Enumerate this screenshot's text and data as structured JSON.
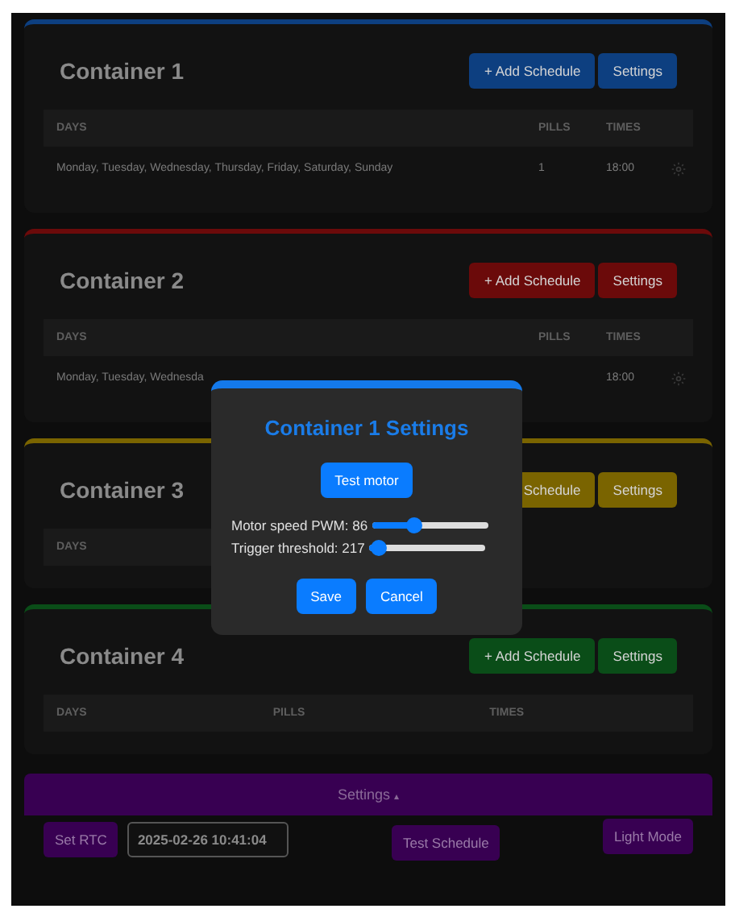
{
  "containers": [
    {
      "title": "Container 1",
      "color": "#0d3f80",
      "buttons": [
        "+ Add Schedule",
        "Settings"
      ],
      "columns": [
        "DAYS",
        "PILLS",
        "TIMES"
      ],
      "rows": [
        {
          "days": "Monday, Tuesday, Wednesday, Thursday, Friday, Saturday, Sunday",
          "pills": "1",
          "times": "18:00"
        }
      ]
    },
    {
      "title": "Container 2",
      "color": "#6b0a0a",
      "buttons": [
        "+ Add Schedule",
        "Settings"
      ],
      "columns": [
        "DAYS",
        "PILLS",
        "TIMES"
      ],
      "rows": [
        {
          "days": "Monday, Tuesday, Wednesda",
          "times": "18:00"
        }
      ]
    },
    {
      "title": "Container 3",
      "color": "#7a6400",
      "buttons": [
        "Schedule",
        "Settings"
      ],
      "columns": [
        "DAYS"
      ]
    },
    {
      "title": "Container 4",
      "color": "#0a4d18",
      "buttons": [
        "+ Add Schedule",
        "Settings"
      ],
      "columns": [
        "DAYS",
        "PILLS",
        "TIMES"
      ]
    }
  ],
  "settings_bar": {
    "label": "Settings",
    "caret": "▴",
    "expanded": true
  },
  "controls": {
    "set_rtc": "Set RTC",
    "datetime": "2025-02-26 10:41:04",
    "test_schedule": "Test Schedule",
    "light_mode": "Light Mode"
  },
  "dialog": {
    "title": "Container 1 Settings",
    "test_button": "Test motor",
    "sliders": [
      {
        "label": "Motor speed PWM: 86",
        "level": 0.36
      },
      {
        "label": "Trigger threshold: 217",
        "level": 0.08
      }
    ],
    "buttons": [
      "Save",
      "Cancel"
    ]
  }
}
